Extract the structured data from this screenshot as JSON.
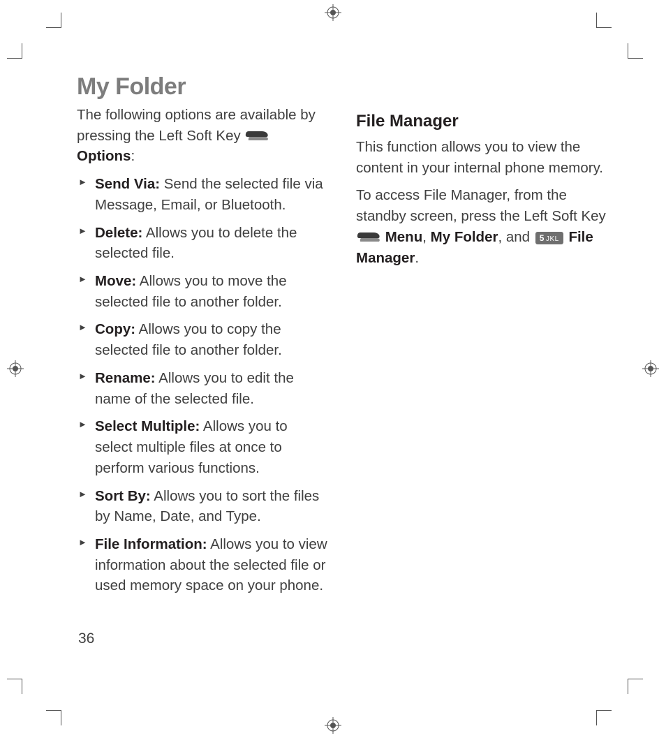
{
  "title": "My Folder",
  "left": {
    "intro_pre": "The following options are available by pressing the Left Soft Key ",
    "intro_key_label": "Options",
    "intro_post": ":",
    "items": [
      {
        "label": "Send Via:",
        "text": " Send the selected file via Message, Email, or Bluetooth."
      },
      {
        "label": "Delete:",
        "text": " Allows you to delete the selected file."
      },
      {
        "label": "Move:",
        "text": " Allows you to move the selected file to another folder."
      },
      {
        "label": "Copy:",
        "text": " Allows you to copy the selected file to another folder."
      },
      {
        "label": "Rename:",
        "text": " Allows you to edit the name of the selected file."
      },
      {
        "label": "Select Multiple:",
        "text": " Allows you to select multiple files at once to perform various functions."
      },
      {
        "label": "Sort By:",
        "text": " Allows you to sort the files by Name, Date, and Type."
      },
      {
        "label": "File Information:",
        "text": " Allows you to view information about the selected file or used memory space on your phone."
      }
    ]
  },
  "right": {
    "heading": "File Manager",
    "p1": "This function allows you to view the content in your internal phone memory.",
    "p2_pre": "To access File Manager, from the standby screen, press the Left Soft Key ",
    "p2_menu": "Menu",
    "p2_mid": ", ",
    "p2_myfolder": "My Folder",
    "p2_and": ", and ",
    "p2_key5": "5 JKL",
    "p2_fm": "File Manager",
    "p2_end": "."
  },
  "page_number": "36"
}
